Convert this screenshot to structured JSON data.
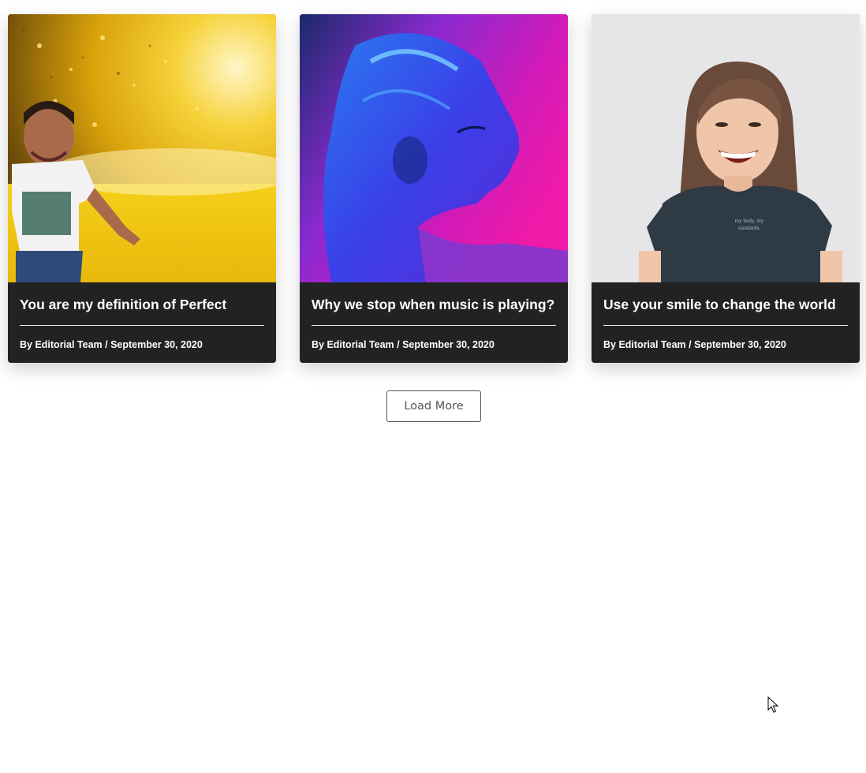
{
  "posts": [
    {
      "image_subject": "child running through water spray",
      "title": "You are my definition of Perfect",
      "meta": "By Editorial Team / September 30, 2020"
    },
    {
      "image_subject": "woman profile in neon blue and pink light",
      "title": "Why we stop when music is playing?",
      "meta": "By Editorial Team / September 30, 2020"
    },
    {
      "image_subject": "smiling woman in dark t-shirt",
      "shirt_text": "my body, my standards.",
      "title": "Use your smile to change the world",
      "meta": "By Editorial Team / September 30, 2020"
    }
  ],
  "load_more": {
    "label": "Load More"
  },
  "cursor": {
    "icon": "arrow-pointer-icon"
  },
  "colors": {
    "card_body": "#222222",
    "card_text": "#ffffff",
    "button_border": "#555555",
    "button_text": "#555555",
    "page_background": "#ffffff"
  }
}
